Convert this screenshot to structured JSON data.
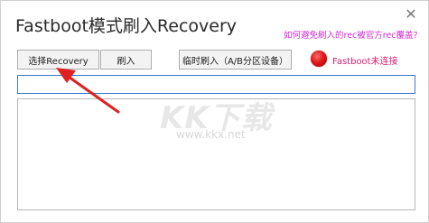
{
  "window": {
    "title": "Fastboot模式刷入Recovery",
    "close_glyph": "✕"
  },
  "help_link": "如何避免刷入的rec被官方rec覆盖?",
  "toolbar": {
    "select_label": "选择Recovery",
    "flash_label": "刷入",
    "temp_flash_label": "临时刷入（A/B分区设备）"
  },
  "status": {
    "text": "Fastboot未连接",
    "indicator_color": "#e01a1a"
  },
  "path_input": {
    "value": ""
  },
  "log": {
    "value": ""
  },
  "watermark": {
    "main": "KK下载",
    "url": "www.kkx.net"
  },
  "annotation": {
    "arrow_color": "#e02020",
    "icon": "red-arrow-icon"
  }
}
